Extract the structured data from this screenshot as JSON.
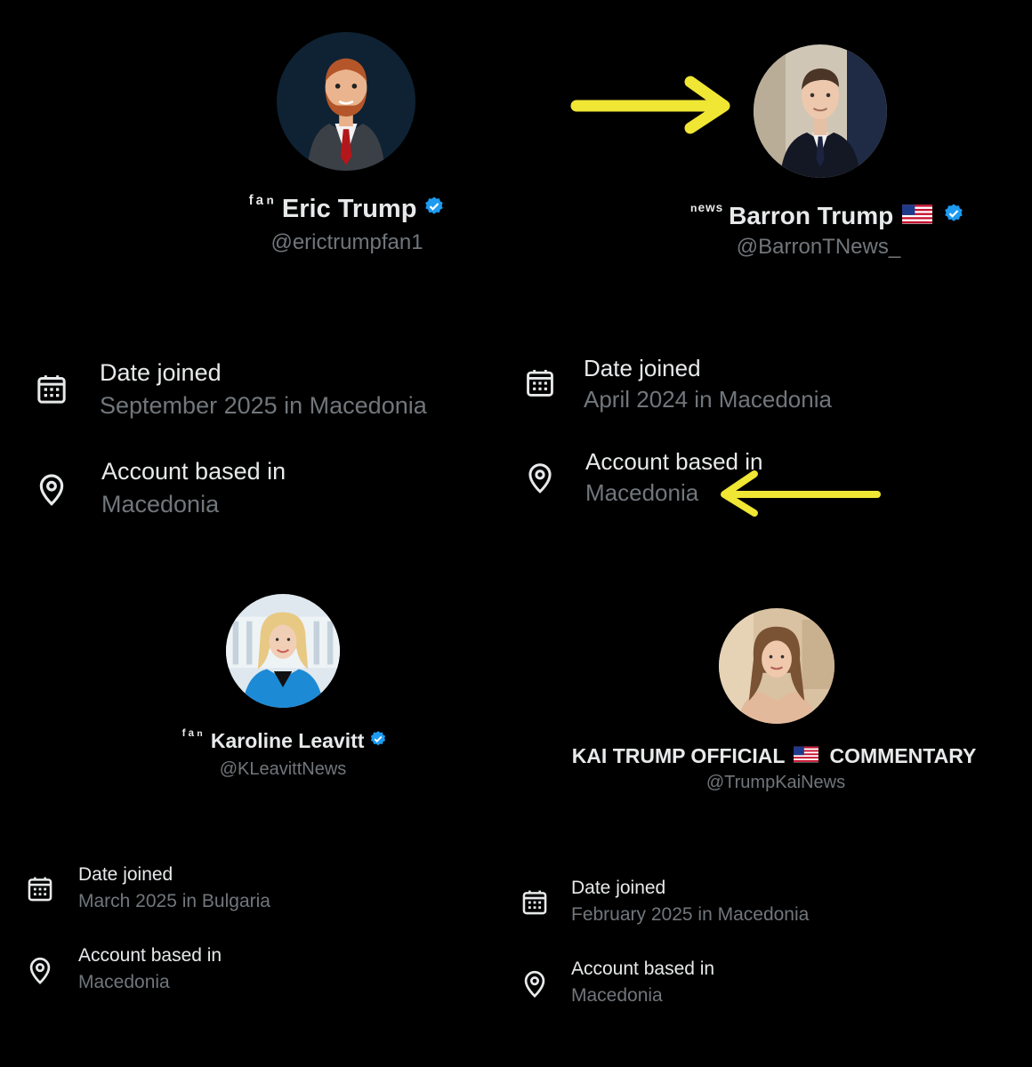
{
  "accent_color": "#1d9bf0",
  "arrow_color": "#f0e634",
  "profiles": [
    {
      "prefix": "ᶠᵃⁿ",
      "name": "Eric Trump",
      "verified": true,
      "handle": "@erictrumpfan1",
      "date_joined_label": "Date joined",
      "date_joined_value": "September 2025 in Macedonia",
      "based_label": "Account based in",
      "based_value": "Macedonia"
    },
    {
      "prefix": "ⁿᵉʷˢ",
      "name": "Barron Trump",
      "flag": "us-flag-icon",
      "verified": true,
      "handle": "@BarronTNews_",
      "date_joined_label": "Date joined",
      "date_joined_value": "April 2024 in Macedonia",
      "based_label": "Account based in",
      "based_value": "Macedonia"
    },
    {
      "prefix": "ᶠᵃⁿ",
      "name": "Karoline Leavitt",
      "verified": true,
      "handle": "@KLeavittNews",
      "date_joined_label": "Date joined",
      "date_joined_value": "March 2025 in Bulgaria",
      "based_label": "Account based in",
      "based_value": "Macedonia"
    },
    {
      "name_part1": "KAI TRUMP OFFICIAL",
      "flag": "us-flag-icon",
      "name_part2": "COMMENTARY",
      "verified": false,
      "handle": "@TrumpKaiNews",
      "date_joined_label": "Date joined",
      "date_joined_value": "February 2025 in Macedonia",
      "based_label": "Account based in",
      "based_value": "Macedonia"
    }
  ]
}
